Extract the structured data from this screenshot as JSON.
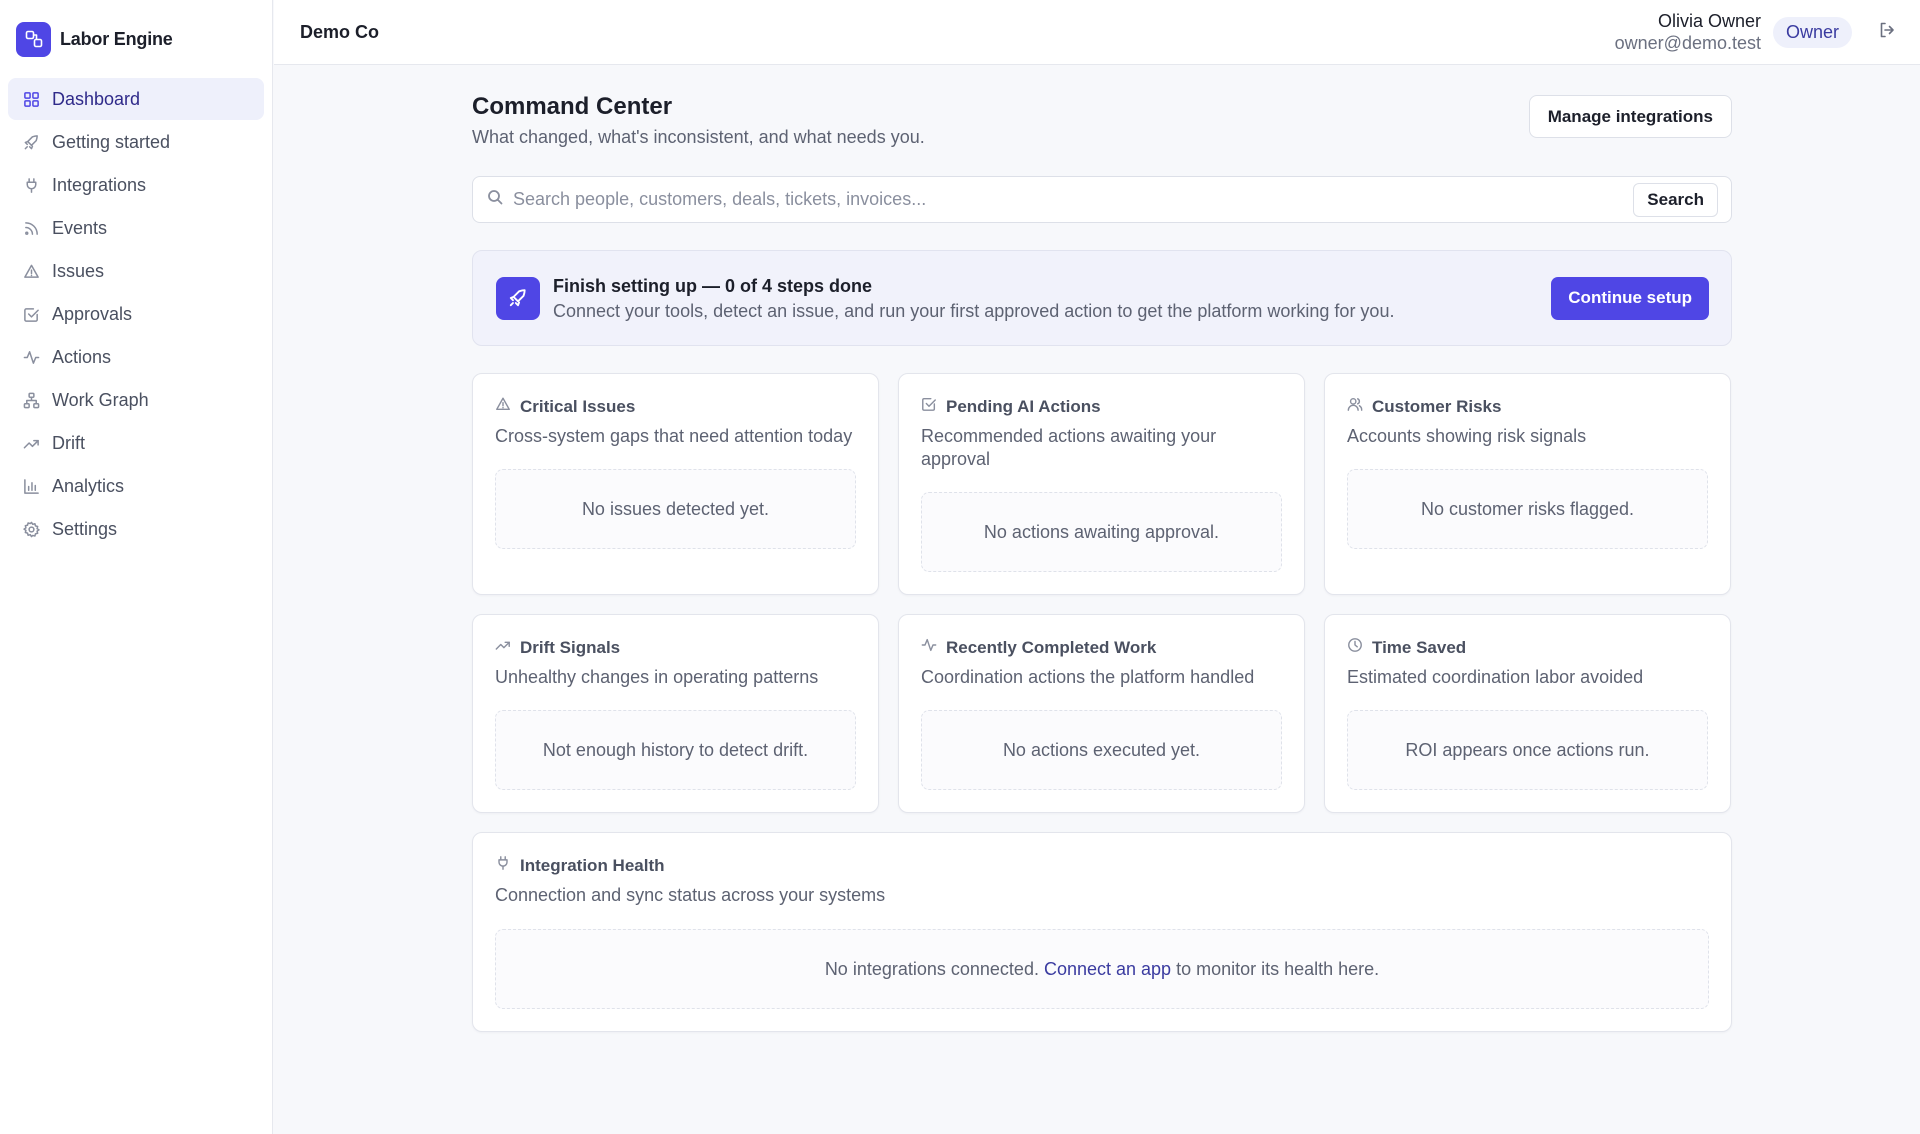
{
  "brand": {
    "name": "Labor Engine",
    "logo_icon": "nodes-icon",
    "accent": "#4f46e5"
  },
  "sidebar": {
    "items": [
      {
        "label": "Dashboard",
        "icon": "grid-icon",
        "active": true
      },
      {
        "label": "Getting started",
        "icon": "rocket-icon"
      },
      {
        "label": "Integrations",
        "icon": "plug-icon"
      },
      {
        "label": "Events",
        "icon": "rss-icon"
      },
      {
        "label": "Issues",
        "icon": "warning-icon"
      },
      {
        "label": "Approvals",
        "icon": "checkbox-icon"
      },
      {
        "label": "Actions",
        "icon": "activity-icon"
      },
      {
        "label": "Work Graph",
        "icon": "graph-icon"
      },
      {
        "label": "Drift",
        "icon": "trend-icon"
      },
      {
        "label": "Analytics",
        "icon": "bar-chart-icon"
      },
      {
        "label": "Settings",
        "icon": "gear-icon"
      }
    ]
  },
  "topbar": {
    "org": "Demo Co",
    "user_name": "Olivia Owner",
    "user_email": "owner@demo.test",
    "role": "Owner",
    "logout_icon": "logout-icon"
  },
  "main": {
    "title": "Command Center",
    "subtitle": "What changed, what's inconsistent, and what needs you.",
    "manage_button": "Manage integrations",
    "search": {
      "placeholder": "Search people, customers, deals, tickets, invoices...",
      "button": "Search"
    },
    "setup": {
      "title": "Finish setting up — 0 of 4 steps done",
      "description": "Connect your tools, detect an issue, and run your first approved action to get the platform working for you.",
      "button": "Continue setup"
    },
    "cards": [
      {
        "title": "Critical Issues",
        "description": "Cross-system gaps that need attention today",
        "empty": "No issues detected yet.",
        "icon": "warning-icon"
      },
      {
        "title": "Pending AI Actions",
        "description": "Recommended actions awaiting your approval",
        "empty": "No actions awaiting approval.",
        "icon": "checkbox-icon"
      },
      {
        "title": "Customer Risks",
        "description": "Accounts showing risk signals",
        "empty": "No customer risks flagged.",
        "icon": "users-icon"
      },
      {
        "title": "Drift Signals",
        "description": "Unhealthy changes in operating patterns",
        "empty": "Not enough history to detect drift.",
        "icon": "trend-icon"
      },
      {
        "title": "Recently Completed Work",
        "description": "Coordination actions the platform handled",
        "empty": "No actions executed yet.",
        "icon": "activity-icon"
      },
      {
        "title": "Time Saved",
        "description": "Estimated coordination labor avoided",
        "empty": "ROI appears once actions run.",
        "icon": "clock-icon"
      }
    ],
    "integration_health": {
      "title": "Integration Health",
      "description": "Connection and sync status across your systems",
      "empty_prefix": "No integrations connected.",
      "empty_link": "Connect an app",
      "empty_suffix": "to monitor its health here.",
      "icon": "plug-icon"
    }
  }
}
